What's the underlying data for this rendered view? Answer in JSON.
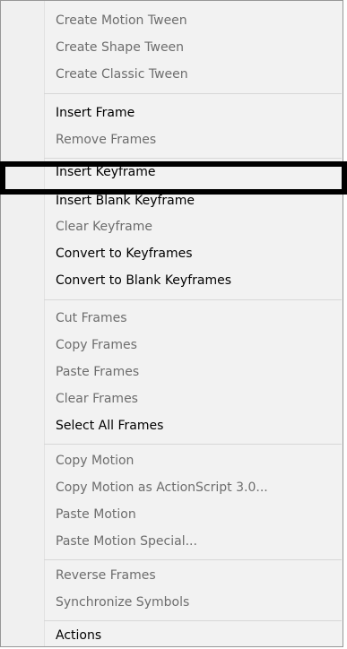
{
  "menu": {
    "items": [
      {
        "label": "Create Motion Tween",
        "enabled": false
      },
      {
        "label": "Create Shape Tween",
        "enabled": false
      },
      {
        "label": "Create Classic Tween",
        "enabled": false
      },
      {
        "label": "Insert Frame",
        "enabled": true
      },
      {
        "label": "Remove Frames",
        "enabled": false
      },
      {
        "label": "Insert Keyframe",
        "enabled": true
      },
      {
        "label": "Insert Blank Keyframe",
        "enabled": true
      },
      {
        "label": "Clear Keyframe",
        "enabled": false
      },
      {
        "label": "Convert to Keyframes",
        "enabled": true
      },
      {
        "label": "Convert to Blank Keyframes",
        "enabled": true
      },
      {
        "label": "Cut Frames",
        "enabled": false
      },
      {
        "label": "Copy Frames",
        "enabled": false
      },
      {
        "label": "Paste Frames",
        "enabled": false
      },
      {
        "label": "Clear Frames",
        "enabled": false
      },
      {
        "label": "Select All Frames",
        "enabled": true
      },
      {
        "label": "Copy Motion",
        "enabled": false
      },
      {
        "label": "Copy Motion as ActionScript 3.0...",
        "enabled": false
      },
      {
        "label": "Paste Motion",
        "enabled": false
      },
      {
        "label": "Paste Motion Special...",
        "enabled": false
      },
      {
        "label": "Reverse Frames",
        "enabled": false
      },
      {
        "label": "Synchronize Symbols",
        "enabled": false
      },
      {
        "label": "Actions",
        "enabled": true
      }
    ]
  },
  "colors": {
    "menu_background": "#f2f2f2",
    "enabled_text": "#000000",
    "disabled_text": "#6d6d6d",
    "separator": "#d7d7d7",
    "highlight_outline": "#000000"
  }
}
